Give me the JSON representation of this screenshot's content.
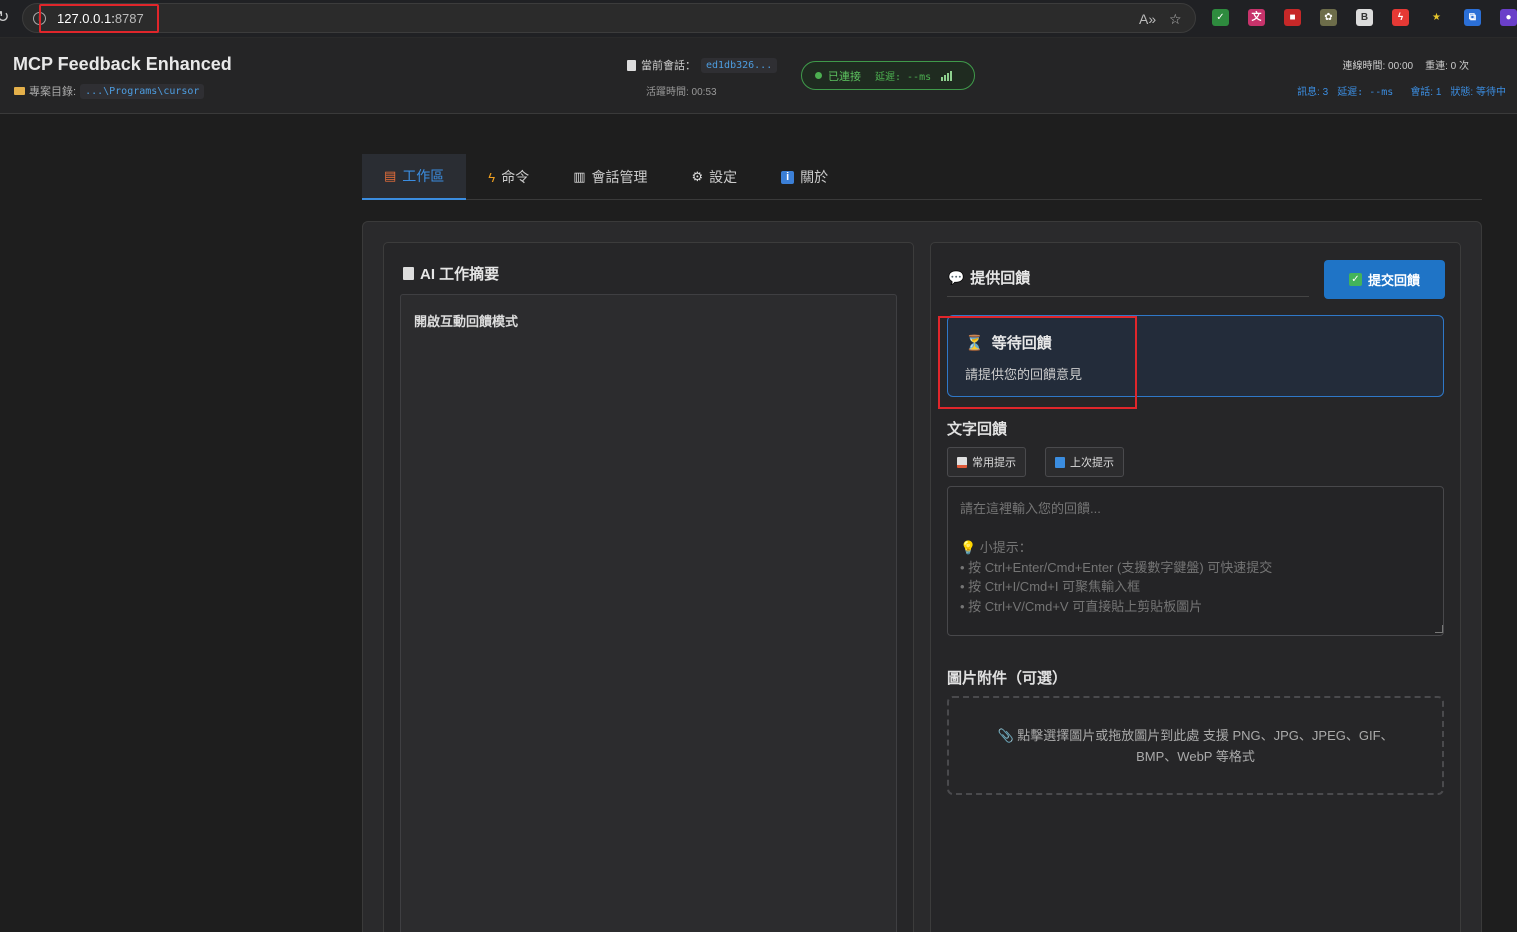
{
  "browser": {
    "url_host": "127.0.0.1:",
    "url_port": "8787"
  },
  "header": {
    "title": "MCP Feedback Enhanced",
    "project_label": "專案目錄:",
    "project_path": "...\\Programs\\cursor",
    "session_label": "當前會話：",
    "session_id": "ed1db326...",
    "session_time": "活躍時間: 00:53",
    "connection_status": "已連接",
    "latency": "延遲: --ms",
    "connect_time": "連線時間: 00:00",
    "reconnect": "重連: 0 次",
    "msg_count": "訊息: 3",
    "latency_stat": "延遲: --ms",
    "session_count": "會話: 1",
    "state": "狀態: 等待中"
  },
  "tabs": [
    {
      "label": "工作區",
      "icon": "document-icon"
    },
    {
      "label": "命令",
      "icon": "lightning-icon"
    },
    {
      "label": "會話管理",
      "icon": "clipboard-icon"
    },
    {
      "label": "設定",
      "icon": "gear-icon"
    },
    {
      "label": "關於",
      "icon": "info-icon"
    }
  ],
  "summary": {
    "title": "AI 工作摘要",
    "content": "開啟互動回饋模式"
  },
  "feedback": {
    "title": "提供回饋",
    "submit_label": "提交回饋",
    "wait_title": "等待回饋",
    "wait_subtitle": "請提供您的回饋意見",
    "text_label": "文字回饋",
    "common_prompts": "常用提示",
    "last_prompt": "上次提示",
    "placeholder": "請在這裡輸入您的回饋...\n\n💡 小提示：\n• 按 Ctrl+Enter/Cmd+Enter (支援數字鍵盤) 可快速提交\n• 按 Ctrl+I/Cmd+I 可聚焦輸入框\n• 按 Ctrl+V/Cmd+V 可直接貼上剪貼板圖片",
    "image_label": "圖片附件（可選）",
    "drop_text": "📎 點擊選擇圖片或拖放圖片到此處 支援 PNG、JPG、JPEG、GIF、BMP、WebP 等格式"
  },
  "colors": {
    "accent": "#1f74c6",
    "connected": "#4caf50",
    "highlight": "#e0262b"
  }
}
